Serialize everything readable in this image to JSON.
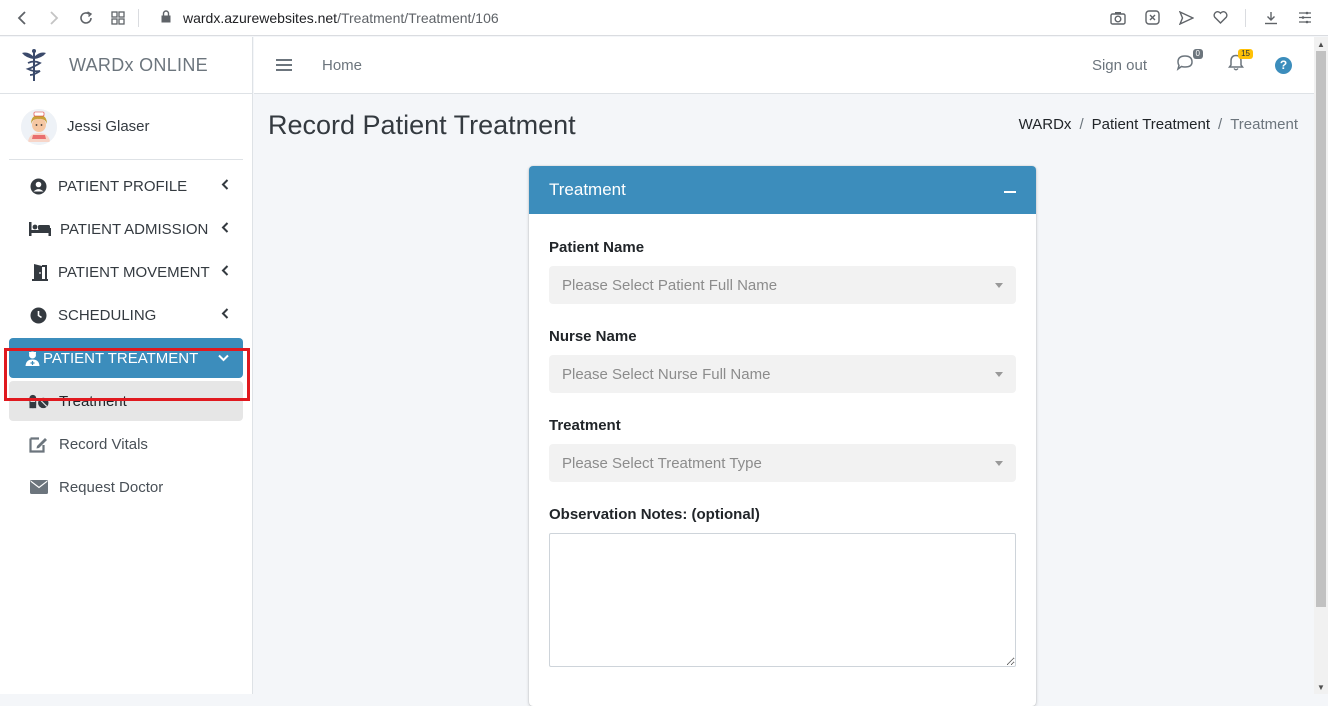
{
  "browser": {
    "url_host": "wardx.azurewebsites.net",
    "url_path": "/Treatment/Treatment/106"
  },
  "brand": {
    "name": "WARDx ONLINE"
  },
  "user": {
    "name": "Jessi Glaser"
  },
  "sidebar": {
    "items": [
      {
        "label": "PATIENT PROFILE",
        "icon": "user-circle-icon"
      },
      {
        "label": "PATIENT ADMISSION",
        "icon": "bed-icon"
      },
      {
        "label": "PATIENT MOVEMENT",
        "icon": "door-open-icon"
      },
      {
        "label": "SCHEDULING",
        "icon": "clock-icon"
      },
      {
        "label": "PATIENT TREATMENT",
        "icon": "user-nurse-icon",
        "active": true
      }
    ],
    "subitems": [
      {
        "label": "Treatment",
        "icon": "pills-icon",
        "selected": true
      },
      {
        "label": "Record Vitals",
        "icon": "edit-icon"
      },
      {
        "label": "Request Doctor",
        "icon": "envelope-icon"
      }
    ]
  },
  "topbar": {
    "home_label": "Home",
    "signout_label": "Sign out",
    "messages_count": "0",
    "notifications_count": "15",
    "help_label": "?"
  },
  "page": {
    "title": "Record Patient Treatment",
    "breadcrumb": [
      "WARDx",
      "Patient Treatment",
      "Treatment"
    ]
  },
  "card": {
    "title": "Treatment",
    "fields": {
      "patient_label": "Patient Name",
      "patient_placeholder": "Please Select Patient Full Name",
      "nurse_label": "Nurse Name",
      "nurse_placeholder": "Please Select Nurse Full Name",
      "treatment_label": "Treatment",
      "treatment_placeholder": "Please Select Treatment Type",
      "notes_label": "Observation Notes: (optional)",
      "notes_value": ""
    }
  },
  "colors": {
    "primary": "#3c8dbc",
    "highlight": "#e0191f",
    "badge_notifications": "#ffc107"
  }
}
